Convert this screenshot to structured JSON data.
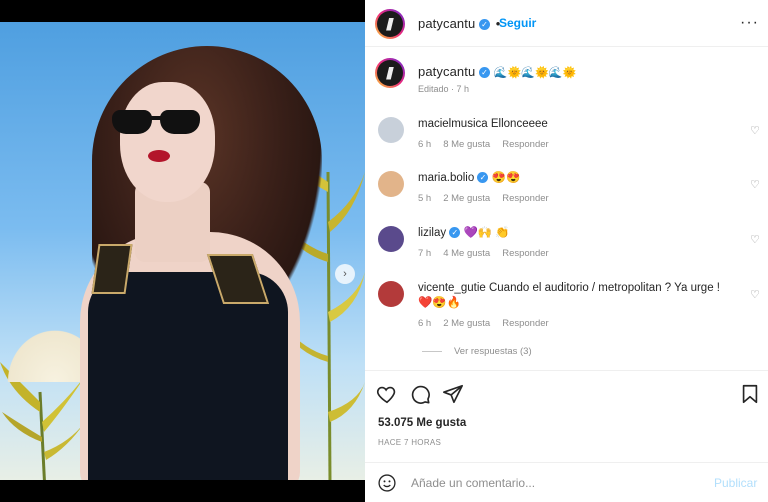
{
  "post": {
    "username": "patycantu",
    "follow_label": "Seguir",
    "more_label": "···",
    "caption_emojis": "🌊🌞🌊🌞🌊🌞",
    "edited_label": "Editado · 7 h",
    "carousel_next": "›"
  },
  "comments": [
    {
      "user": "macielmusica",
      "verified": false,
      "text": "Ellonceeee",
      "time": "6 h",
      "likes": "8 Me gusta",
      "reply": "Responder",
      "avatar_color": "#c8d0da"
    },
    {
      "user": "maria.bolio",
      "verified": true,
      "text": "😍😍",
      "time": "5 h",
      "likes": "2 Me gusta",
      "reply": "Responder",
      "avatar_color": "#e2b48a"
    },
    {
      "user": "lizilay",
      "verified": true,
      "text": "💜🙌 👏",
      "time": "7 h",
      "likes": "4 Me gusta",
      "reply": "Responder",
      "avatar_color": "#5a4a8c"
    },
    {
      "user": "vicente_gutie",
      "verified": false,
      "text": "Cuando el auditorio / metropolitan ? Ya urge ! ❤️😍🔥",
      "time": "6 h",
      "likes": "2 Me gusta",
      "reply": "Responder",
      "avatar_color": "#b33a3a"
    }
  ],
  "view_replies": "Ver respuestas (3)",
  "likes_count": "53.075 Me gusta",
  "posted_ago": "HACE 7 HORAS",
  "comment_box": {
    "placeholder": "Añade un comentario...",
    "post_label": "Publicar"
  },
  "carousel": {
    "total": 4,
    "active_index": 0
  },
  "colors": {
    "link": "#0095f6",
    "verified": "#3897f0",
    "muted": "#8e8e8e"
  }
}
